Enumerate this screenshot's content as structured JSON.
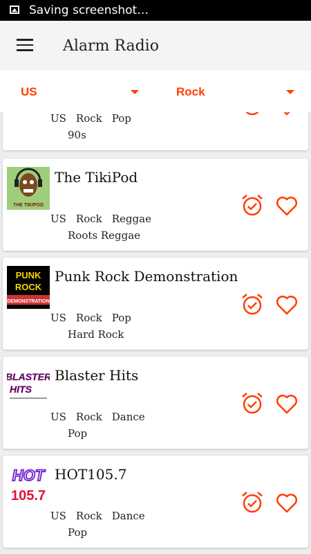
{
  "status_bar": {
    "text": "Saving screenshot…",
    "icon": "image-icon"
  },
  "app_bar": {
    "title": "Alarm Radio",
    "menu_icon": "hamburger-menu-icon"
  },
  "filters": {
    "country": "US",
    "genre": "Rock",
    "accent_color": "#ff3d00"
  },
  "stations": [
    {
      "name": "",
      "tags": [
        "US",
        "Rock",
        "Pop"
      ],
      "subgenre": "90s"
    },
    {
      "name": "The TikiPod",
      "logo_text": "THE TIKIPOD",
      "tags": [
        "US",
        "Rock",
        "Reggae"
      ],
      "subgenre": "Roots Reggae"
    },
    {
      "name": "Punk Rock Demonstration",
      "logo_text": [
        "PUNK",
        "ROCK",
        "DEMONSTRATION"
      ],
      "tags": [
        "US",
        "Rock",
        "Pop"
      ],
      "subgenre": "Hard Rock"
    },
    {
      "name": "Blaster Hits",
      "logo_text": [
        "BLASTER",
        "HITS"
      ],
      "tags": [
        "US",
        "Rock",
        "Dance"
      ],
      "subgenre": "Pop"
    },
    {
      "name": "HOT105.7",
      "logo_text": [
        "HOT",
        "105.7"
      ],
      "tags": [
        "US",
        "Rock",
        "Dance"
      ],
      "subgenre": "Pop"
    }
  ]
}
